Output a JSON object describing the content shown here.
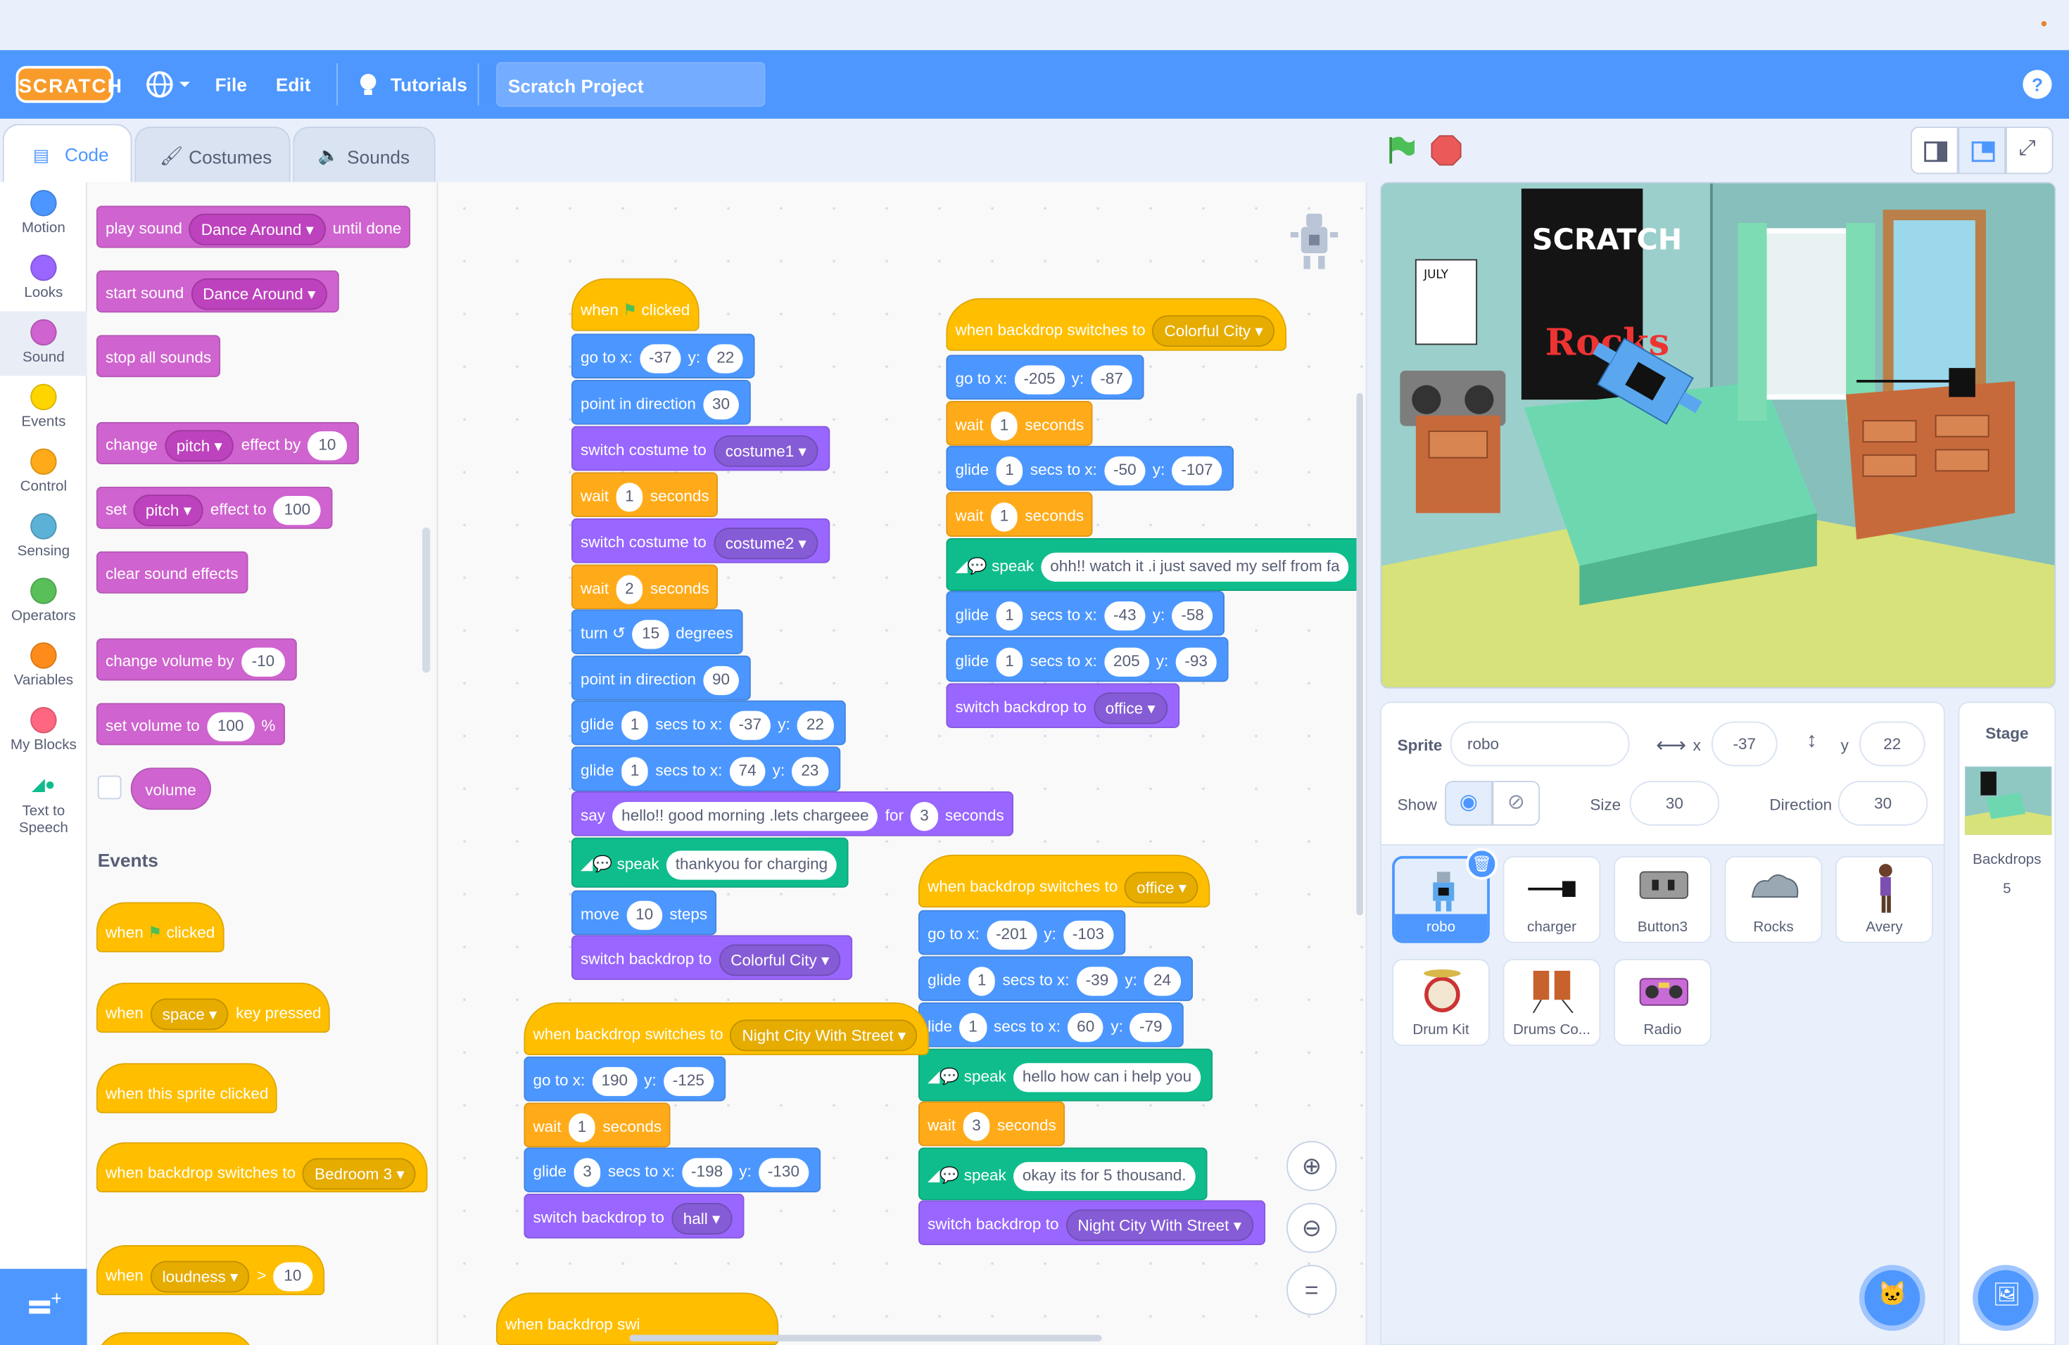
{
  "app": {
    "logo": "SCRATCH",
    "project_title": "Scratch Project",
    "accent": "#4d97ff"
  },
  "menu": {
    "globe_icon": "globe-icon",
    "file": "File",
    "edit": "Edit",
    "tutorials": "Tutorials",
    "help": "?"
  },
  "tabs": {
    "code": "Code",
    "costumes": "Costumes",
    "sounds": "Sounds"
  },
  "categories": [
    {
      "label": "Motion",
      "color": "#4c97ff"
    },
    {
      "label": "Looks",
      "color": "#9966ff"
    },
    {
      "label": "Sound",
      "color": "#cf63cf"
    },
    {
      "label": "Events",
      "color": "#ffd500"
    },
    {
      "label": "Control",
      "color": "#ffab19"
    },
    {
      "label": "Sensing",
      "color": "#5cb1d6"
    },
    {
      "label": "Operators",
      "color": "#59c059"
    },
    {
      "label": "Variables",
      "color": "#ff8c1a"
    },
    {
      "label": "My Blocks",
      "color": "#ff6680"
    },
    {
      "label": "Text to Speech",
      "color": "#0fbd8c"
    }
  ],
  "palette": {
    "play_sound": "play sound",
    "play_sound_value": "Dance Around",
    "until_done": "until done",
    "start_sound": "start sound",
    "start_sound_value": "Dance Around",
    "stop_all_sounds": "stop all sounds",
    "change": "change",
    "change_effect": "pitch",
    "effect_by": "effect by",
    "change_val": "10",
    "set": "set",
    "set_effect": "pitch",
    "effect_to": "effect to",
    "set_val": "100",
    "clear_sound_effects": "clear sound effects",
    "change_volume_by": "change volume by",
    "change_volume_val": "-10",
    "set_volume_to": "set volume to",
    "set_volume_val": "100",
    "percent": "%",
    "volume": "volume",
    "events_title": "Events",
    "when": "when",
    "clicked": "clicked",
    "key": "space",
    "key_pressed": "key pressed",
    "when_sprite_clicked": "when this sprite clicked",
    "when_backdrop_switches_to": "when backdrop switches to",
    "backdrop_value": "Bedroom 3",
    "loudness": "loudness",
    "gt": ">",
    "loudness_val": "10"
  },
  "script1": {
    "when": "when",
    "clicked": "clicked",
    "goto": "go to x:",
    "x": "-37",
    "y_lbl": "y:",
    "y": "22",
    "point": "point in direction",
    "dir1": "30",
    "switch_costume": "switch costume to",
    "costume1": "costume1",
    "wait": "wait",
    "w1": "1",
    "seconds": "seconds",
    "costume2": "costume2",
    "w2": "2",
    "turn": "turn",
    "turn_val": "15",
    "degrees": "degrees",
    "dir2": "90",
    "glide": "glide",
    "secs_to_x": "secs to x:",
    "g1_t": "1",
    "g1_x": "-37",
    "g1_y": "22",
    "g2_t": "1",
    "g2_x": "74",
    "g2_y": "23",
    "say": "say",
    "say_text": "hello!!  good morning .lets chargeee",
    "for": "for",
    "say_secs": "3",
    "speak": "speak",
    "speak_text": "thankyou for charging",
    "move": "move",
    "move_val": "10",
    "steps": "steps",
    "switch_backdrop": "switch backdrop to",
    "backdrop": "Colorful City"
  },
  "script2": {
    "hat": "when backdrop switches to",
    "hat_val": "Colorful City",
    "goto_x": "-205",
    "goto_y": "-87",
    "w1": "1",
    "g1_t": "1",
    "g1_x": "-50",
    "g1_y": "-107",
    "w2": "1",
    "speak_text": "ohh!! watch it .i just saved my self from fa",
    "g2_t": "1",
    "g2_x": "-43",
    "g2_y": "-58",
    "g3_t": "1",
    "g3_x": "205",
    "g3_y": "-93",
    "backdrop": "office"
  },
  "script3": {
    "hat_val": "office",
    "goto_x": "-201",
    "goto_y": "-103",
    "g1_t": "1",
    "g1_x": "-39",
    "g1_y": "24",
    "g2_t": "1",
    "g2_x": "60",
    "g2_y": "-79",
    "glide_label": "lide",
    "speak1": "hello how can i help you",
    "w1": "3",
    "speak2": "okay its for 5 thousand.",
    "backdrop": "Night City With Street"
  },
  "script4": {
    "hat_val": "Night City With Street",
    "goto_x": "190",
    "goto_y": "-125",
    "w1": "1",
    "g1_t": "3",
    "g1_x": "-198",
    "g1_y": "-130",
    "backdrop": "hall"
  },
  "script5": {
    "hat": "when backdrop swi"
  },
  "zoom": {
    "in": "+",
    "out": "−",
    "reset": "="
  },
  "sprite_info": {
    "sprite_label": "Sprite",
    "name": "robo",
    "x_label": "x",
    "x": "-37",
    "y_label": "y",
    "y": "22",
    "show_label": "Show",
    "size_label": "Size",
    "size": "30",
    "direction_label": "Direction",
    "direction": "30"
  },
  "sprites": [
    "robo",
    "charger",
    "Button3",
    "Rocks",
    "Avery",
    "Drum Kit",
    "Drums Co...",
    "Radio"
  ],
  "stage_panel": {
    "title": "Stage",
    "backdrops_label": "Backdrops",
    "backdrops_count": "5"
  },
  "stage_art": {
    "poster_line1": "SCRATCH",
    "poster_line2": "Rocks",
    "calendar": "JULY"
  }
}
